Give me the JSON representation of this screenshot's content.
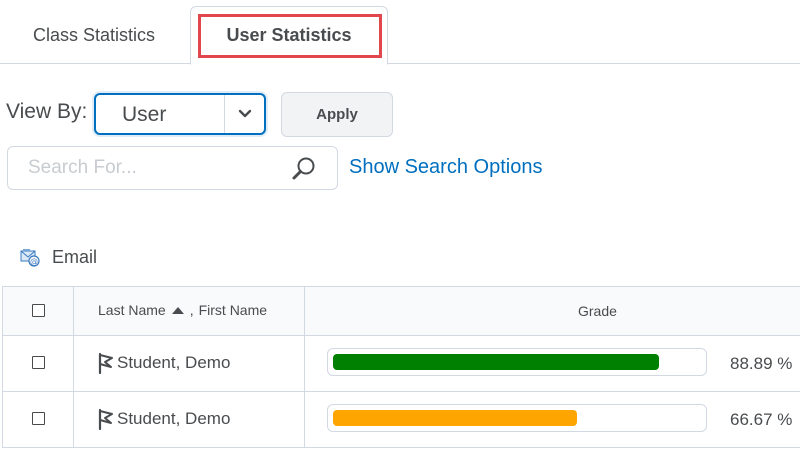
{
  "tabs": [
    {
      "label": "Class Statistics",
      "active": false
    },
    {
      "label": "User Statistics",
      "active": true
    }
  ],
  "view_by": {
    "label": "View By:",
    "selected": "User",
    "apply_label": "Apply"
  },
  "search": {
    "placeholder": "Search For...",
    "value": "",
    "options_link": "Show Search Options"
  },
  "actions": {
    "email_label": "Email"
  },
  "table": {
    "headers": {
      "last_name": "Last Name",
      "first_name": "First Name",
      "name_separator": ",",
      "grade": "Grade"
    },
    "rows": [
      {
        "name": "Student, Demo",
        "grade_text": "88.89 %",
        "grade_value": 88.89,
        "bar_color": "#008000"
      },
      {
        "name": "Student, Demo",
        "grade_text": "66.67 %",
        "grade_value": 66.67,
        "bar_color": "#ffa500"
      }
    ]
  },
  "colors": {
    "link": "#006fbf",
    "highlight": "#e2474d",
    "border": "#d3d9e3"
  },
  "icons": {
    "select_arrow": "chevron-down-icon",
    "search": "magnifier-icon",
    "email": "email-icon",
    "sort": "sort-ascending-icon",
    "row_flag": "flag-icon"
  }
}
